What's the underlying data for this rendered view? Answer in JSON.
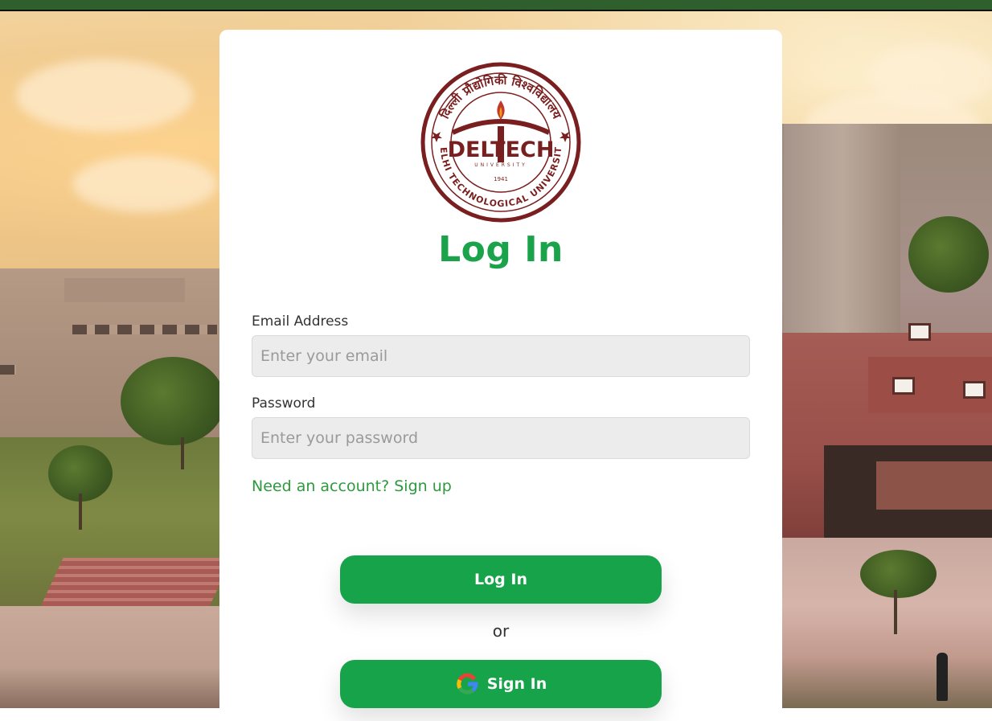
{
  "login": {
    "title": "Log In",
    "logo_alt": "Delhi Technological University seal",
    "email": {
      "label": "Email Address",
      "placeholder": "Enter your email",
      "value": ""
    },
    "password": {
      "label": "Password",
      "placeholder": "Enter your password",
      "value": ""
    },
    "signup_link": "Need an account? Sign up",
    "login_button": "Log In",
    "separator": "or",
    "google_button": "Sign In"
  },
  "colors": {
    "accent": "#17a34a",
    "title": "#1aa34a",
    "topbar": "#2f5f2c",
    "logo_maroon": "#7a1f1f"
  },
  "logo": {
    "brand": "DELTECH",
    "university_text": "UNIVERSITY",
    "institution": "DELHI TECHNOLOGICAL UNIVERSITY",
    "year": "1941",
    "hindi_text": "दिल्ली प्रौद्योगिकी विश्वविद्यालय"
  },
  "icons": {
    "google": "google-g-icon"
  }
}
